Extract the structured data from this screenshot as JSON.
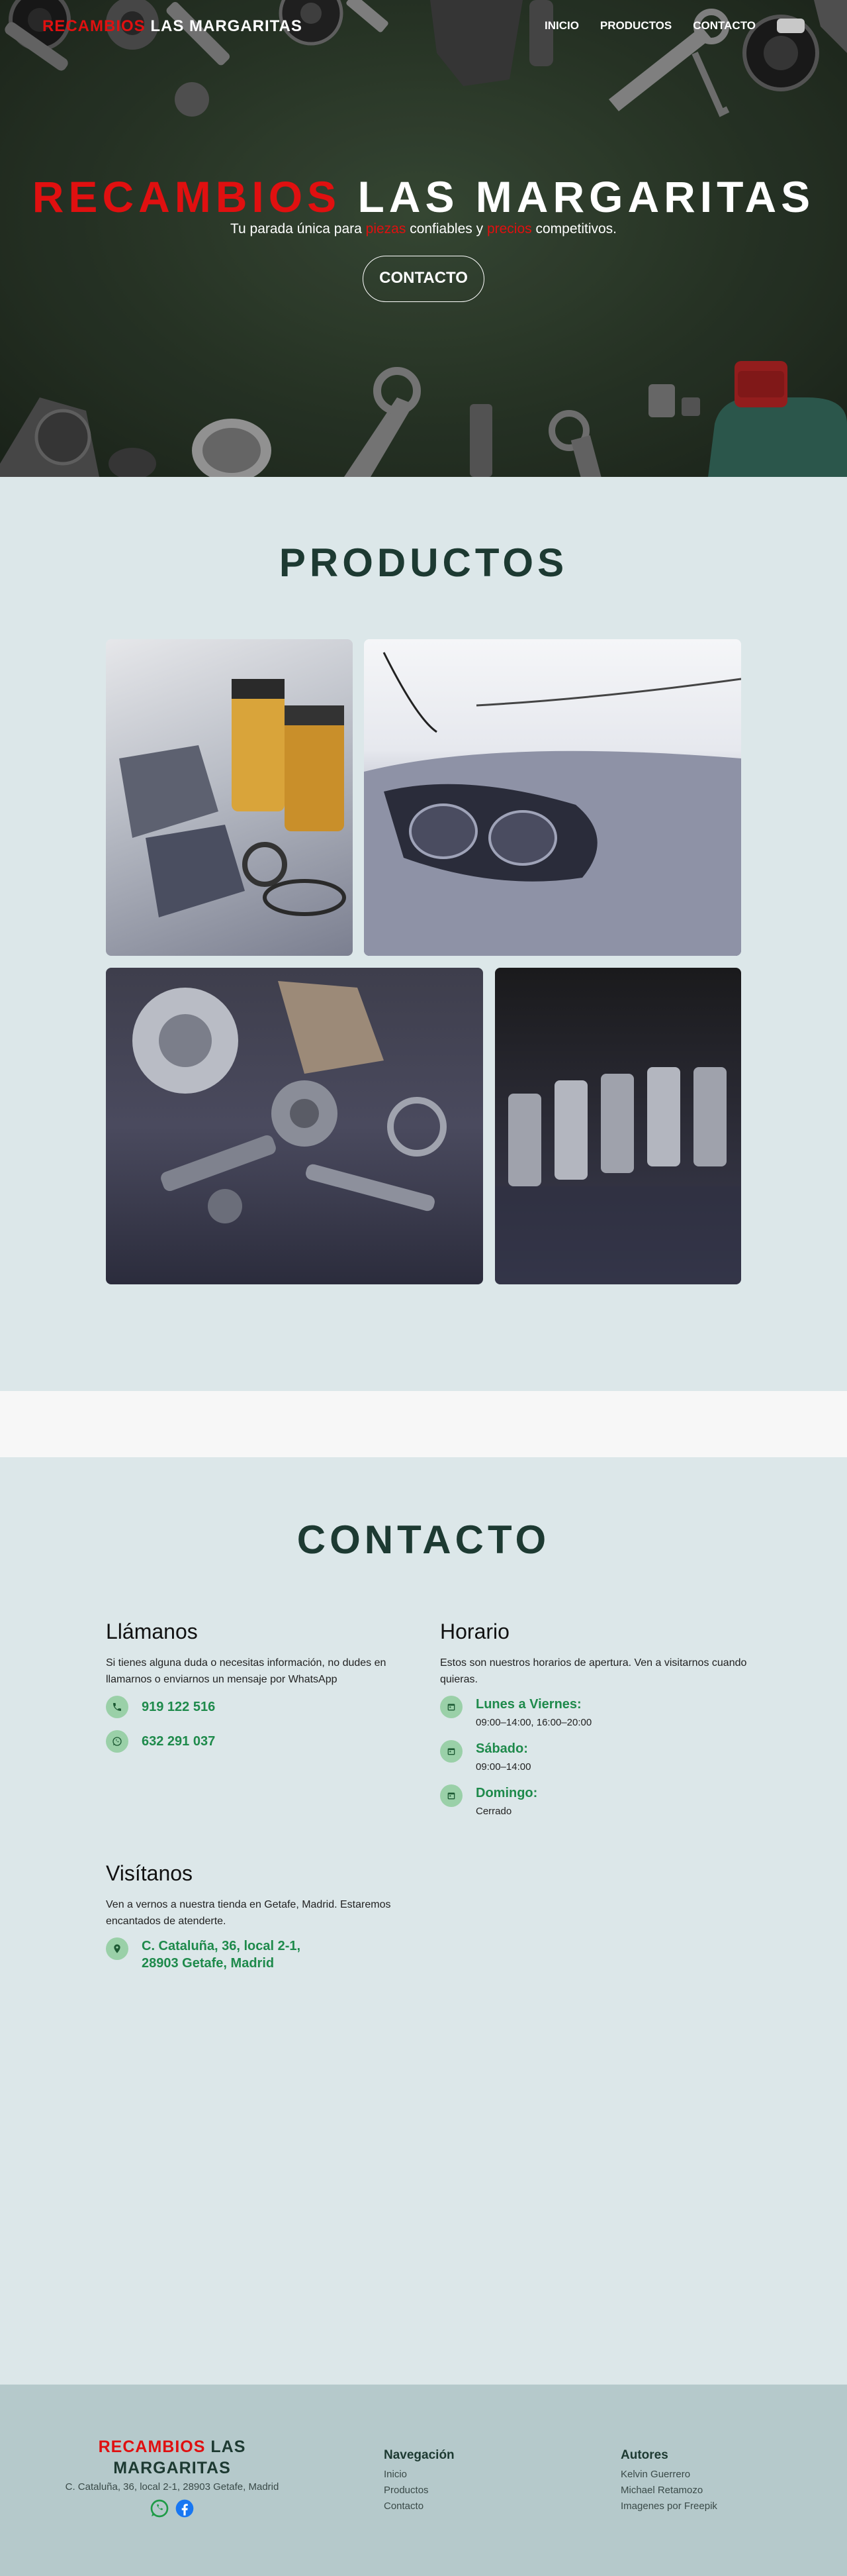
{
  "nav": {
    "brand_red": "RECAMBIOS",
    "brand_rest": " LAS MARGARITAS",
    "links": [
      "INICIO",
      "PRODUCTOS",
      "CONTACTO"
    ]
  },
  "hero": {
    "title_red": "RECAMBIOS",
    "title_rest": " LAS MARGARITAS",
    "subtitle_a": "Tu parada única para ",
    "subtitle_red1": "piezas",
    "subtitle_b": " confiables y ",
    "subtitle_red2": "precios",
    "subtitle_c": " competitivos.",
    "button": "CONTACTO"
  },
  "productos": {
    "title": "PRODUCTOS"
  },
  "contacto": {
    "title": "CONTACTO",
    "llamanos": {
      "heading": "Llámanos",
      "desc": "Si tienes alguna duda o necesitas información, no dudes en llamarnos o enviarnos un mensaje por WhatsApp",
      "phone": "919 122 516",
      "whatsapp": "632 291 037"
    },
    "horario": {
      "heading": "Horario",
      "desc": "Estos son nuestros horarios de apertura. Ven a visitarnos cuando quieras.",
      "days": [
        {
          "label": "Lunes a Viernes:",
          "hours": "09:00–14:00, 16:00–20:00"
        },
        {
          "label": "Sábado:",
          "hours": "09:00–14:00"
        },
        {
          "label": "Domingo:",
          "hours": "Cerrado"
        }
      ]
    },
    "visitanos": {
      "heading": "Visítanos",
      "desc": "Ven a vernos a nuestra tienda en Getafe, Madrid. Estaremos encantados de atenderte.",
      "address": "C. Cataluña, 36, local 2-1, 28903 Getafe, Madrid"
    }
  },
  "footer": {
    "brand_red": "RECAMBIOS",
    "brand_rest": " LAS MARGARITAS",
    "address": "C. Cataluña, 36, local 2-1, 28903 Getafe, Madrid",
    "nav_heading": "Navegación",
    "nav_links": [
      "Inicio",
      "Productos",
      "Contacto"
    ],
    "authors_heading": "Autores",
    "authors": [
      "Kelvin Guerrero",
      "Michael Retamozo",
      "Imagenes por Freepik"
    ]
  },
  "colors": {
    "accent_red": "#e01010",
    "contact_green": "#1e8a4b",
    "title_dark": "#1d3a32",
    "page_bg": "#dce7e9",
    "footer_bg": "#b5c9cb"
  }
}
